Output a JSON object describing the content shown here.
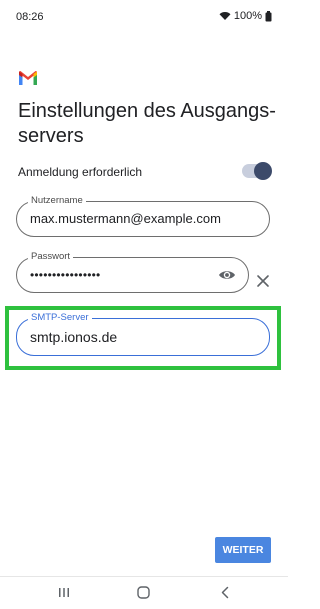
{
  "status_bar": {
    "time": "08:26",
    "battery": "100%"
  },
  "app": {
    "logo": "gmail-logo",
    "title": "Einstellungen des Ausgangs-servers",
    "title_line1": "Einstellungen des Ausgangs-",
    "title_line2": "servers"
  },
  "auth_required": {
    "label": "Anmeldung erforderlich",
    "enabled": true
  },
  "fields": {
    "username": {
      "label": "Nutzername",
      "value": "max.mustermann@example.com"
    },
    "password": {
      "label": "Passwort",
      "value": "••••••••••••••••"
    },
    "smtp_server": {
      "label": "SMTP-Server",
      "value": "smtp.ionos.de"
    }
  },
  "buttons": {
    "next_label": "WEITER"
  },
  "icons": {
    "password_visibility": "eye-icon",
    "clear": "close-icon",
    "nav_recents": "recents-icon",
    "nav_home": "home-icon",
    "nav_back": "back-icon"
  },
  "colors": {
    "accent": "#3a6fd8",
    "button": "#4a86e0",
    "highlight": "#2ec13e",
    "toggle_track": "#c8cedd",
    "toggle_knob": "#3c4a6a"
  }
}
